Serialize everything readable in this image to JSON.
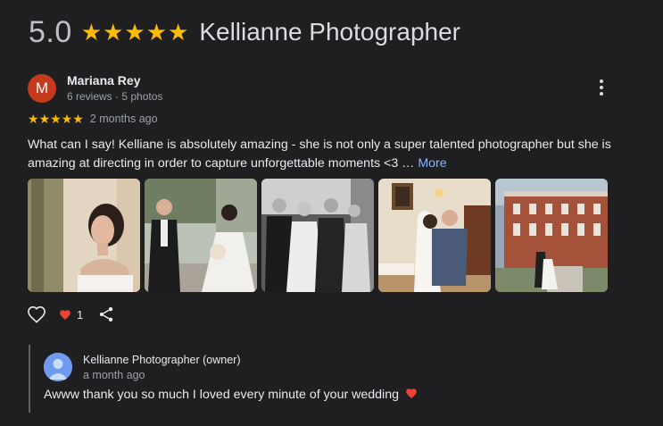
{
  "header": {
    "rating": "5.0",
    "stars": [
      "★",
      "★",
      "★",
      "★",
      "★"
    ],
    "business_name": "Kellianne Photographer"
  },
  "review": {
    "avatar_letter": "M",
    "reviewer_name": "Mariana Rey",
    "reviewer_meta": "6 reviews · 5 photos",
    "stars": [
      "★",
      "★",
      "★",
      "★",
      "★"
    ],
    "time": "2 months ago",
    "text": "What can I say! Kelliane is absolutely amazing - she is not only a super talented photographer but she is amazing at directing in order to capture unforgettable moments <3 …",
    "more_label": "More",
    "like_count": "1",
    "photo_count": 5
  },
  "owner_reply": {
    "name": "Kellianne Photographer (owner)",
    "time": "a month ago",
    "text": "Awww thank you so much I loved every minute of your wedding"
  },
  "colors": {
    "background": "#1f1f22",
    "star": "#fbbc04",
    "link": "#8ab4f8",
    "avatar": "#c5391c",
    "heart": "#ea4335"
  },
  "icons": {
    "more": "more-vert-icon",
    "like": "heart-outline-icon",
    "liked": "heart-filled-icon",
    "share": "share-icon"
  }
}
